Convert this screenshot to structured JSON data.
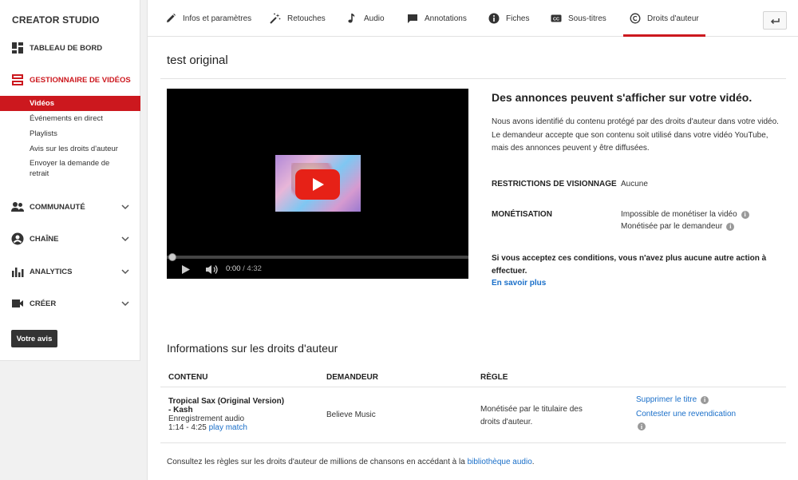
{
  "sidebar": {
    "title": "CREATOR STUDIO",
    "dashboard": "TABLEAU DE BORD",
    "video_manager": "GESTIONNAIRE DE VIDÉOS",
    "sub_items": [
      "Vidéos",
      "Événements en direct",
      "Playlists",
      "Avis sur les droits d'auteur",
      "Envoyer la demande de retrait"
    ],
    "community": "COMMUNAUTÉ",
    "channel": "CHAÎNE",
    "analytics": "ANALYTICS",
    "create": "CRÉER",
    "feedback_button": "Votre avis"
  },
  "tabs": [
    "Infos et paramètres",
    "Retouches",
    "Audio",
    "Annotations",
    "Fiches",
    "Sous-titres",
    "Droits d'auteur"
  ],
  "active_tab": "Droits d'auteur",
  "video": {
    "title": "test original",
    "current_time": "0:00",
    "duration": "/ 4:32",
    "progress": 0
  },
  "info": {
    "heading": "Des annonces peuvent s'afficher sur votre vidéo.",
    "desc_line1": "Nous avons identifié du contenu protégé par des droits d'auteur dans votre vidéo.",
    "desc_line2": "Le demandeur accepte que son contenu soit utilisé dans votre vidéo YouTube, mais des annonces peuvent y être diffusées.",
    "restrictions_label": "RESTRICTIONS DE VISIONNAGE",
    "restrictions_value": "Aucune",
    "monetization_label": "MONÉTISATION",
    "monetization_value1": "Impossible de monétiser la vidéo",
    "monetization_value2": "Monétisée par le demandeur",
    "accept_text": "Si vous acceptez ces conditions, vous n'avez plus aucune autre action à effectuer.",
    "learn_more": "En savoir plus"
  },
  "copyright": {
    "heading": "Informations sur les droits d'auteur",
    "headers": [
      "CONTENU",
      "DEMANDEUR",
      "RÈGLE"
    ],
    "row": {
      "title_line1": "Tropical Sax (Original Version)",
      "title_line2": "- Kash",
      "type": "Enregistrement audio",
      "range": "1:14 - 4:25",
      "play_match": "play match",
      "claimant": "Believe Music",
      "rule_line1": "Monétisée par le titulaire des",
      "rule_line2": "droits d'auteur.",
      "action_remove": "Supprimer le titre",
      "action_dispute": "Contester une revendication"
    }
  },
  "footer": {
    "text": "Consultez les règles sur les droits d'auteur de millions de chansons en accédant à la",
    "link": "bibliothèque audio",
    "end": "."
  },
  "colors": {
    "accent": "#cc181e",
    "link": "#1a6fc9",
    "dark": "#333333"
  }
}
